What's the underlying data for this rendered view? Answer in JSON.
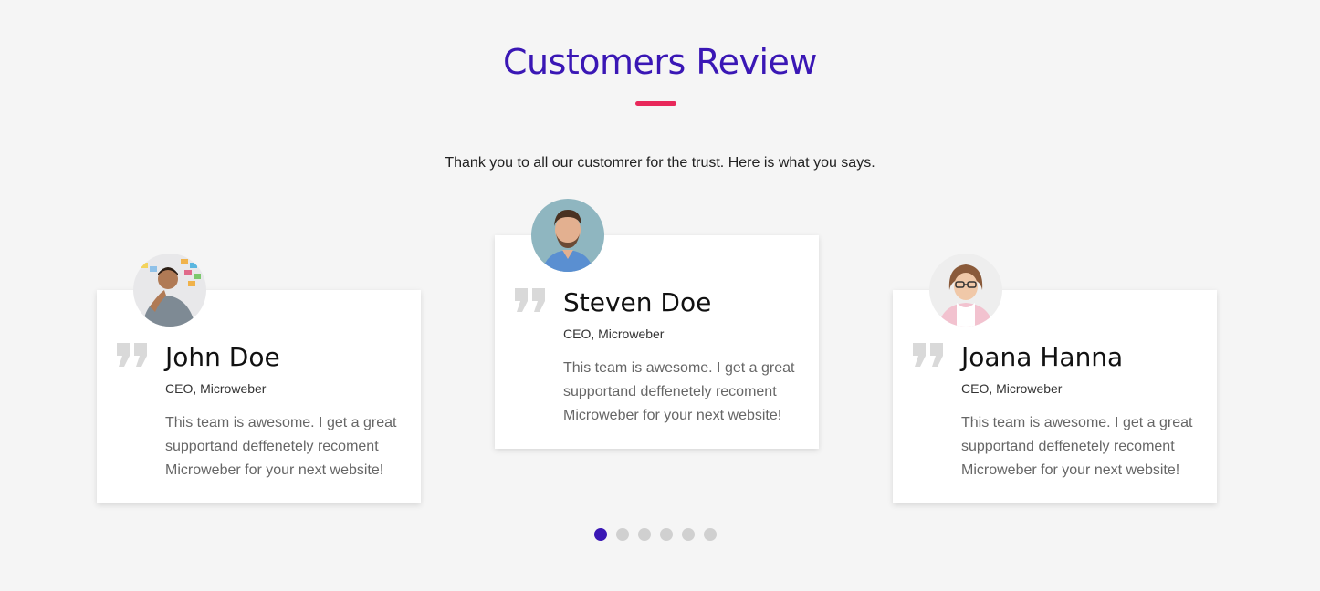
{
  "header": {
    "title": "Customers Review",
    "subtitle": "Thank you to all our customrer for the trust. Here is what you says."
  },
  "colors": {
    "title": "#3a17b5",
    "accent_underline": "#e8285a",
    "quote_icon": "#d9d9d9",
    "dot_active": "#3a17b5",
    "dot_inactive": "#d0d0d0",
    "card_bg": "#ffffff",
    "page_bg": "#f5f5f5"
  },
  "testimonials": [
    {
      "name": "John Doe",
      "role": "CEO, Microweber",
      "text": "This team is awesome. I get a great supportand deffenetely recoment Microweber for your next website!",
      "icon": "quote-icon"
    },
    {
      "name": "Steven Doe",
      "role": "CEO, Microweber",
      "text": "This team is awesome. I get a great supportand deffenetely recoment Microweber for your next website!",
      "icon": "quote-icon"
    },
    {
      "name": "Joana Hanna",
      "role": "CEO, Microweber",
      "text": "This team is awesome. I get a great supportand deffenetely recoment Microweber for your next website!",
      "icon": "quote-icon"
    }
  ],
  "pagination": {
    "count": 6,
    "active_index": 0
  }
}
